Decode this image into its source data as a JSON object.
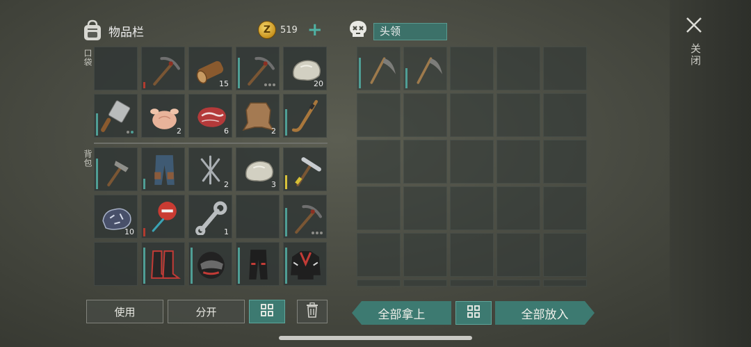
{
  "inventory": {
    "title": "物品栏",
    "pocket_label": "口袋",
    "backpack_label": "背包",
    "coins": "519",
    "add_icon": "plus-icon",
    "buttons": {
      "use": "使用",
      "split": "分开"
    },
    "pocket": [
      {
        "icon": "empty"
      },
      {
        "icon": "pickaxe",
        "durability": 0.15,
        "bar": "red"
      },
      {
        "icon": "log",
        "count": "15"
      },
      {
        "icon": "pickaxe",
        "durability": 0.75,
        "bar": "teal",
        "dots": [
          0,
          0,
          0
        ]
      },
      {
        "icon": "stone",
        "count": "20"
      },
      {
        "icon": "cleaver",
        "durability": 0.55,
        "bar": "teal",
        "dots": [
          0,
          1
        ]
      },
      {
        "icon": "raw-chicken",
        "count": "2"
      },
      {
        "icon": "raw-meat",
        "count": "6"
      },
      {
        "icon": "hide",
        "count": "2"
      },
      {
        "icon": "hockey-stick",
        "durability": 0.65,
        "bar": "teal"
      }
    ],
    "backpack": [
      {
        "icon": "stone-hammer",
        "durability": 0.75,
        "bar": "teal"
      },
      {
        "icon": "jeans",
        "durability": 0.25,
        "bar": "teal"
      },
      {
        "icon": "nails",
        "count": "2"
      },
      {
        "icon": "stone",
        "count": "3"
      },
      {
        "icon": "hammer",
        "durability": 0.35,
        "bar": "yellow"
      },
      {
        "icon": "iron-ore",
        "count": "10"
      },
      {
        "icon": "stop-sign",
        "durability": 0.2,
        "bar": "red"
      },
      {
        "icon": "wrench",
        "count": "1"
      },
      {
        "icon": "empty"
      },
      {
        "icon": "pickaxe",
        "durability": 0.7,
        "bar": "teal",
        "dots": [
          0,
          0,
          0
        ]
      },
      {
        "icon": "empty"
      },
      {
        "icon": "moto-boots",
        "durability": 0.9,
        "bar": "teal"
      },
      {
        "icon": "moto-helmet",
        "durability": 0.9,
        "bar": "teal"
      },
      {
        "icon": "moto-pants",
        "durability": 0.9,
        "bar": "teal"
      },
      {
        "icon": "moto-jacket",
        "durability": 0.9,
        "bar": "teal"
      }
    ]
  },
  "loot": {
    "name": "头领",
    "skull_icon": "skull-icon",
    "slots": [
      {
        "icon": "scythe",
        "durability": 0.75,
        "bar": "teal"
      },
      {
        "icon": "scythe",
        "durability": 0.5,
        "bar": "teal"
      }
    ],
    "buttons": {
      "take_all": "全部拿上",
      "put_all": "全部放入"
    }
  },
  "close_label": "关闭",
  "colors": {
    "accent": "#3d7a71",
    "durability_teal": "#4f9e95",
    "durability_red": "#b23b2f",
    "durability_yellow": "#d8c23a",
    "coin": "#e0b23a"
  }
}
